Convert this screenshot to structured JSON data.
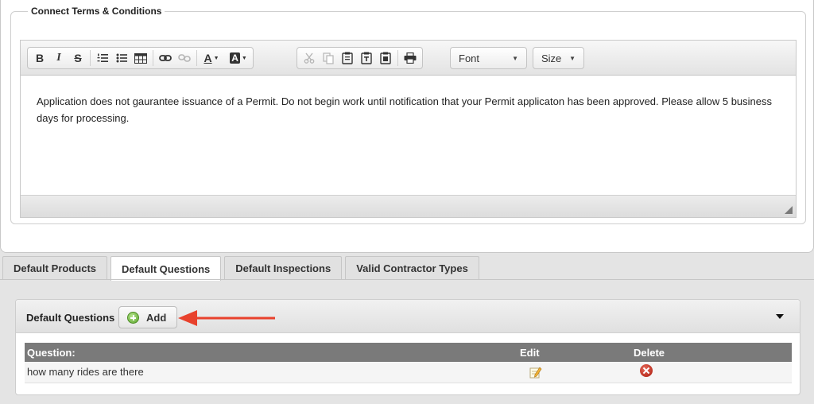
{
  "terms": {
    "legend": "Connect Terms & Conditions",
    "body_text": "Application does not gaurantee issuance of a Permit. Do not begin work until notification that your Permit applicaton has been approved. Please allow 5 business days for processing."
  },
  "toolbar": {
    "icons": [
      "bold-icon",
      "italic-icon",
      "strikethrough-icon",
      "numbered-list-icon",
      "bulleted-list-icon",
      "table-icon",
      "link-icon",
      "unlink-icon",
      "text-color-icon",
      "background-color-icon",
      "cut-icon",
      "copy-icon",
      "paste-icon",
      "paste-text-icon",
      "paste-word-icon",
      "print-icon"
    ],
    "bold": "B",
    "italic": "I",
    "strike": "S",
    "text_color": "A",
    "bg_color": "A",
    "font_label": "Font",
    "size_label": "Size"
  },
  "tabs": [
    {
      "label": "Default Products",
      "active": false
    },
    {
      "label": "Default Questions",
      "active": true
    },
    {
      "label": "Default Inspections",
      "active": false
    },
    {
      "label": "Valid Contractor Types",
      "active": false
    }
  ],
  "questions": {
    "title": "Default Questions",
    "add_label": "Add",
    "columns": [
      "Question:",
      "Edit",
      "Delete"
    ],
    "rows": [
      {
        "question": "how many rides are there"
      }
    ]
  },
  "colors": {
    "annotation_arrow": "#e8412c",
    "table_header": "#7a7a7a",
    "add_icon": "#5aa52c",
    "delete_icon": "#a8190c"
  }
}
